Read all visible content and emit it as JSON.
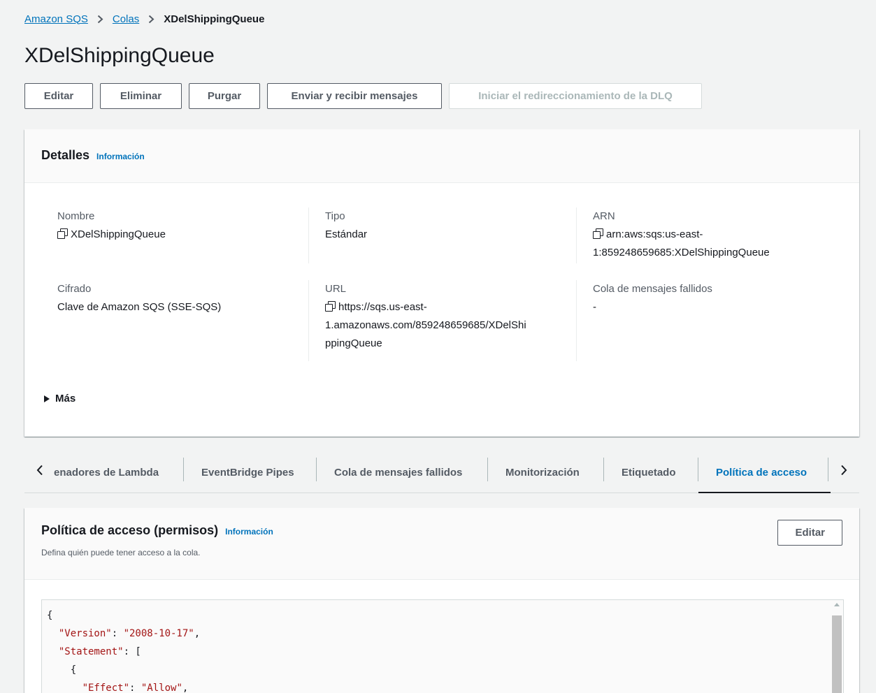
{
  "breadcrumb": {
    "items": [
      "Amazon SQS",
      "Colas"
    ],
    "current": "XDelShippingQueue"
  },
  "page_title": "XDelShippingQueue",
  "actions": {
    "edit": "Editar",
    "delete": "Eliminar",
    "purge": "Purgar",
    "send_receive": "Enviar y recibir mensajes",
    "dlq_redrive": "Iniciar el redireccionamiento de la DLQ"
  },
  "details": {
    "title": "Detalles",
    "info": "Información",
    "name_label": "Nombre",
    "name_value": "XDelShippingQueue",
    "type_label": "Tipo",
    "type_value": "Estándar",
    "arn_label": "ARN",
    "arn_line1": "arn:aws:sqs:us-east-",
    "arn_line2": "1:859248659685:XDelShippingQueue",
    "encryption_label": "Cifrado",
    "encryption_value": "Clave de Amazon SQS (SSE-SQS)",
    "url_label": "URL",
    "url_line1": "https://sqs.us-east-",
    "url_line2": "1.amazonaws.com/859248659685/XDelShi",
    "url_line3": "ppingQueue",
    "dlq_label": "Cola de mensajes fallidos",
    "dlq_value": "-",
    "more": "Más"
  },
  "tabs": {
    "items": [
      "enadores de Lambda",
      "EventBridge Pipes",
      "Cola de mensajes fallidos",
      "Monitorización",
      "Etiquetado",
      "Política de acceso"
    ],
    "active": "Política de acceso"
  },
  "policy": {
    "title": "Política de acceso (permisos)",
    "info": "Información",
    "subtitle": "Defina quién puede tener acceso a la cola.",
    "edit": "Editar",
    "lines": [
      {
        "pre": "{",
        "key": "",
        "mid": "",
        "val": "",
        "post": ""
      },
      {
        "pre": "  ",
        "key": "\"Version\"",
        "mid": ": ",
        "val": "\"2008-10-17\"",
        "post": ","
      },
      {
        "pre": "  ",
        "key": "\"Statement\"",
        "mid": ": [",
        "val": "",
        "post": ""
      },
      {
        "pre": "    {",
        "key": "",
        "mid": "",
        "val": "",
        "post": ""
      },
      {
        "pre": "      ",
        "key": "\"Effect\"",
        "mid": ": ",
        "val": "\"Allow\"",
        "post": ","
      }
    ]
  }
}
